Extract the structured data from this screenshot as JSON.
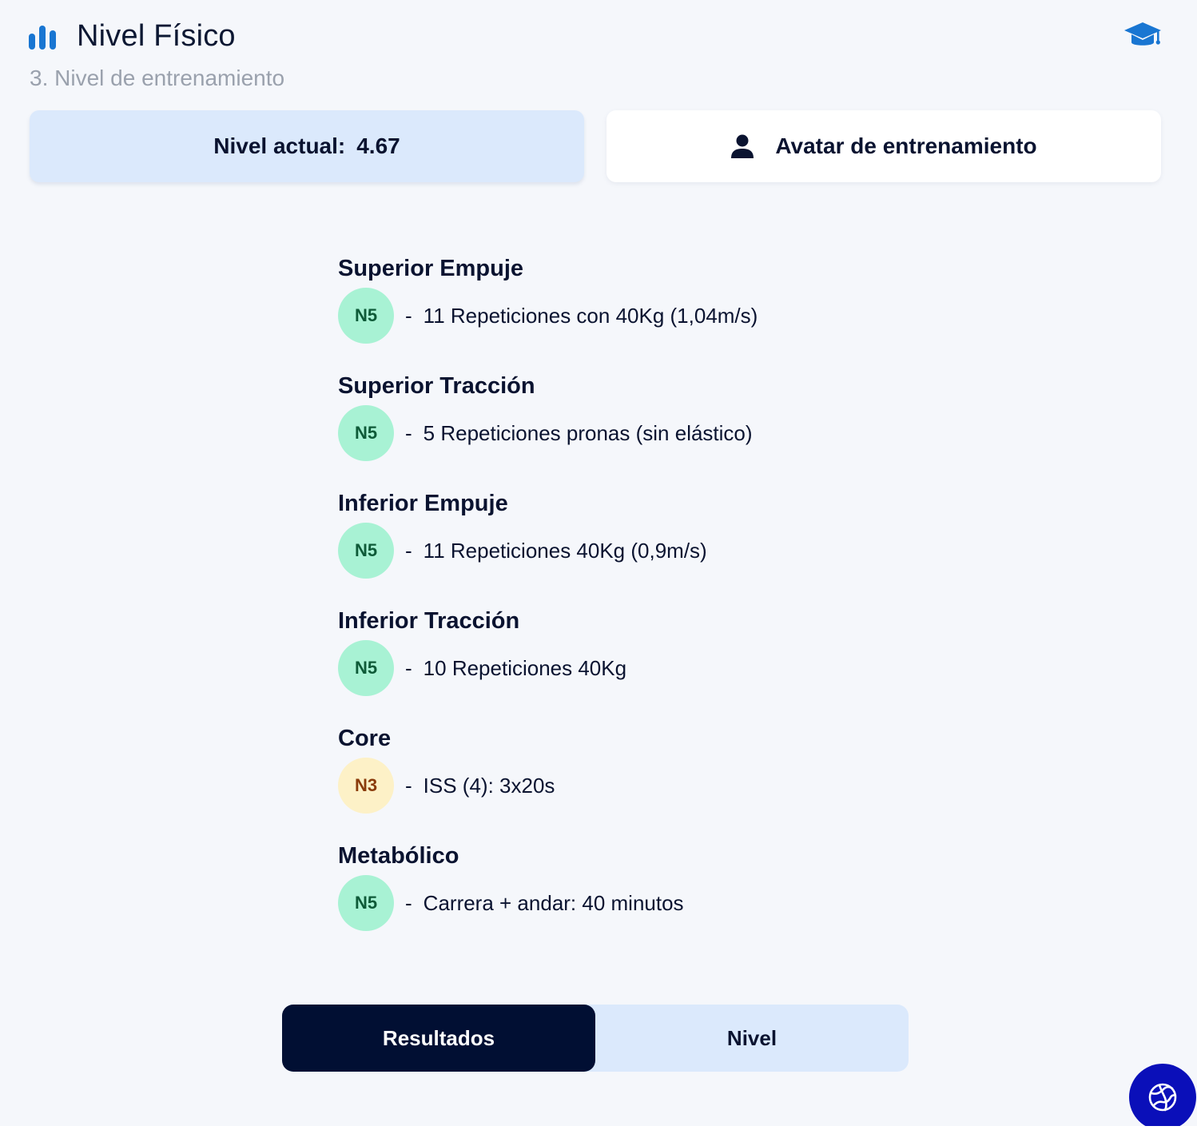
{
  "header": {
    "title": "Nivel Físico",
    "subtitle": "3. Nivel de entrenamiento",
    "title_icon": "bar-chart-icon",
    "action_icon": "graduation-cap-icon"
  },
  "summary": {
    "level_label": "Nivel actual:",
    "level_value": "4.67",
    "avatar_label": "Avatar de entrenamiento",
    "avatar_icon": "person-icon"
  },
  "categories": [
    {
      "title": "Superior Empuje",
      "level": "N5",
      "separator": "-",
      "description": "11 Repeticiones con 40Kg (1,04m/s)"
    },
    {
      "title": "Superior Tracción",
      "level": "N5",
      "separator": "-",
      "description": "5 Repeticiones pronas (sin elástico)"
    },
    {
      "title": "Inferior Empuje",
      "level": "N5",
      "separator": "-",
      "description": "11 Repeticiones 40Kg (0,9m/s)"
    },
    {
      "title": "Inferior Tracción",
      "level": "N5",
      "separator": "-",
      "description": "10 Repeticiones 40Kg"
    },
    {
      "title": "Core",
      "level": "N3",
      "separator": "-",
      "description": "ISS (4): 3x20s"
    },
    {
      "title": "Metabólico",
      "level": "N5",
      "separator": "-",
      "description": "Carrera + andar: 40 minutos"
    }
  ],
  "toggle": {
    "results_label": "Resultados",
    "level_label": "Nivel",
    "active": "Resultados"
  },
  "fab": {
    "icon": "globe-icon"
  },
  "colors": {
    "accent_blue": "#1976d2",
    "card_light_blue": "#dbe9fc",
    "badge_green_bg": "#a8f2d4",
    "badge_green_text": "#0e5a38",
    "badge_yellow_bg": "#fdf1c7",
    "badge_yellow_text": "#8a3b0b",
    "dark_navy": "#010f33",
    "fab_blue": "#0a0fb9"
  }
}
